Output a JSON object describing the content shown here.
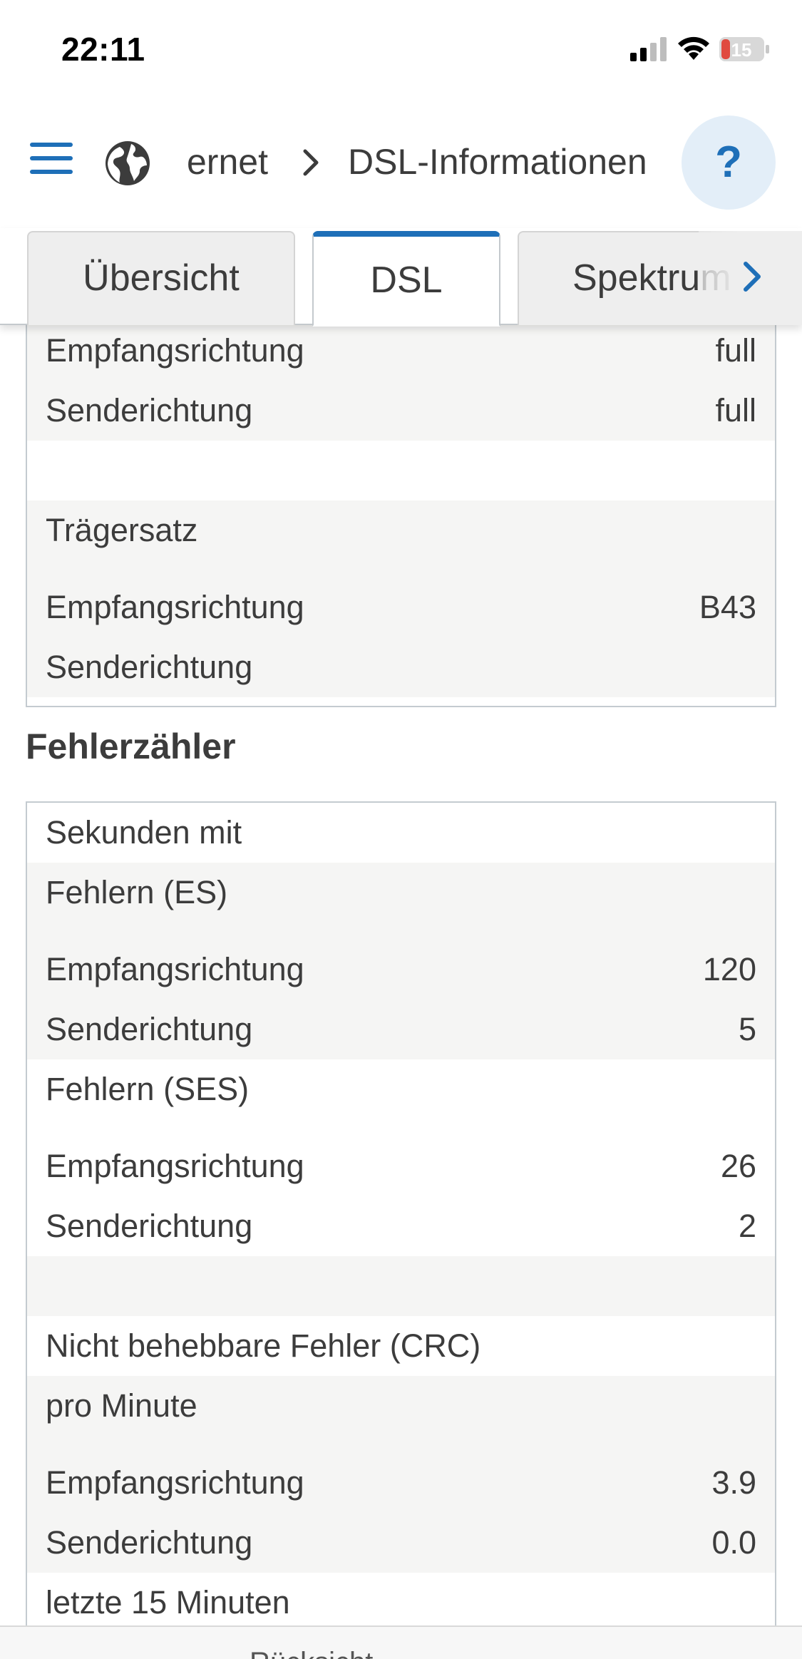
{
  "status_bar": {
    "time": "22:11",
    "battery": "15"
  },
  "header": {
    "breadcrumb_1": "ernet",
    "breadcrumb_2": "DSL-Informationen",
    "help_label": "?"
  },
  "tabs": [
    {
      "label": "Übersicht",
      "active": false
    },
    {
      "label": "DSL",
      "active": true
    },
    {
      "label": "Spektrum",
      "active": false
    }
  ],
  "colors": {
    "accent": "#1e6fb8",
    "row_alt": "#f5f5f4",
    "border": "#c4cbd0",
    "battery_low": "#e04a3f"
  },
  "icons": {
    "menu": "hamburger-icon",
    "globe": "globe-icon",
    "chevron": "chevron-right-icon",
    "next_tab": "chevron-right-icon"
  },
  "section_top": {
    "rows": [
      {
        "label": "Empfangsrichtung",
        "value": "full"
      },
      {
        "label": "Senderichtung",
        "value": "full"
      },
      {
        "label": "",
        "value": ""
      },
      {
        "label": "Trägersatz",
        "value": ""
      },
      {
        "label": "Empfangsrichtung",
        "value": "B43"
      },
      {
        "label": "Senderichtung",
        "value": ""
      }
    ]
  },
  "fehlerzaehler": {
    "title": "Fehlerzähler",
    "rows": [
      {
        "label": "Sekunden mit",
        "value": ""
      },
      {
        "label": "Fehlern (ES)",
        "value": ""
      },
      {
        "label": "Empfangsrichtung",
        "value": "120"
      },
      {
        "label": "Senderichtung",
        "value": "5"
      },
      {
        "label": "Fehlern (SES)",
        "value": ""
      },
      {
        "label": "Empfangsrichtung",
        "value": "26"
      },
      {
        "label": "Senderichtung",
        "value": "2"
      },
      {
        "label": "",
        "value": ""
      },
      {
        "label": "Nicht behebbare Fehler (CRC)",
        "value": ""
      },
      {
        "label": "pro Minute",
        "value": ""
      },
      {
        "label": "Empfangsrichtung",
        "value": "3.9"
      },
      {
        "label": "Senderichtung",
        "value": "0.0"
      },
      {
        "label": "letzte 15 Minuten",
        "value": ""
      }
    ]
  },
  "bottom_bar": {
    "text": "Rücksicht..."
  }
}
